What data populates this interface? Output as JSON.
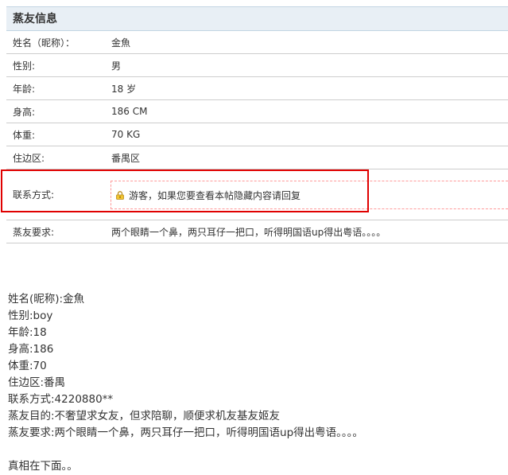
{
  "panel": {
    "title": "蒸友信息",
    "rows": [
      {
        "label": "姓名（昵称）：",
        "value": "金魚"
      },
      {
        "label": "性别:",
        "value": "男"
      },
      {
        "label": "年龄:",
        "value": "18 岁"
      },
      {
        "label": "身高:",
        "value": "186 CM"
      },
      {
        "label": "体重:",
        "value": "70 KG"
      },
      {
        "label": "住边区:",
        "value": "番禺区"
      }
    ],
    "contact": {
      "label": "联系方式:",
      "hidden_notice": "游客，如果您要查看本帖隐藏内容请回复"
    },
    "requirement": {
      "label": "蒸友要求:",
      "value": "两个眼睛一个鼻，两只耳仔一把口，听得明国语up得出粤语。。。。"
    }
  },
  "post_text": {
    "lines": [
      "姓名(昵称):金魚",
      "性别:boy",
      "年龄:18",
      "身高:186",
      "体重:70",
      "住边区:番禺",
      "联系方式:4220880**",
      "蒸友目的:不奢望求女友，但求陪聊，顺便求机友基友姬友",
      "蒸友要求:两个眼睛一个鼻，两只耳仔一把口，听得明国语up得出粤语。。。。"
    ],
    "footer": "真相在下面。。"
  },
  "colors": {
    "header_bg": "#e8eff5",
    "highlight_border": "#e00000",
    "dashed_border": "#ff9a9a"
  }
}
